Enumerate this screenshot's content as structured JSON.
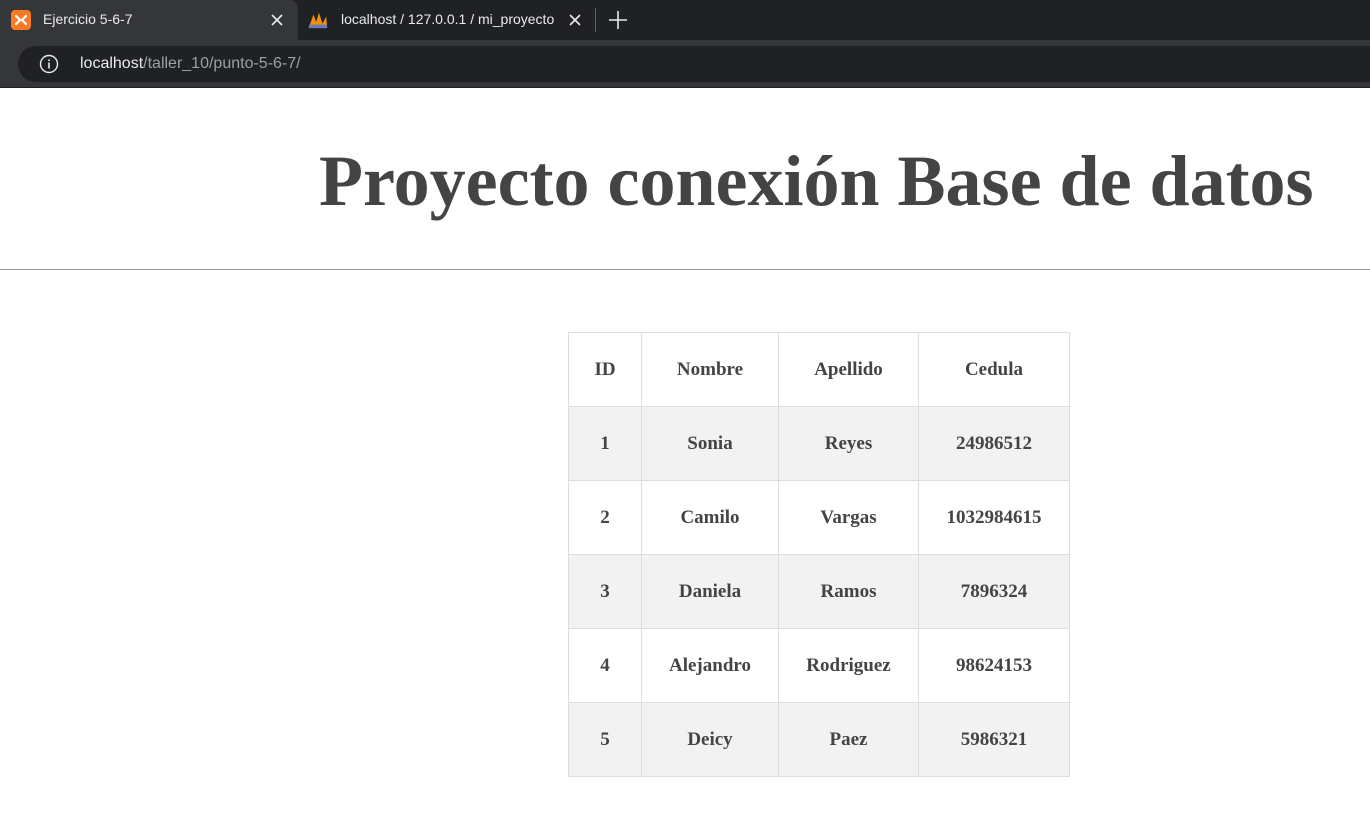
{
  "browser": {
    "tabs": [
      {
        "title": "Ejercicio 5-6-7",
        "favicon": "xampp-icon",
        "active": true
      },
      {
        "title": "localhost / 127.0.0.1 / mi_proyecto",
        "favicon": "phpmyadmin-icon",
        "active": false
      }
    ],
    "address": {
      "host": "localhost",
      "path": "/taller_10/punto-5-6-7/"
    }
  },
  "page": {
    "title": "Proyecto conexión Base de datos",
    "table": {
      "headers": [
        "ID",
        "Nombre",
        "Apellido",
        "Cedula"
      ],
      "rows": [
        [
          "1",
          "Sonia",
          "Reyes",
          "24986512"
        ],
        [
          "2",
          "Camilo",
          "Vargas",
          "1032984615"
        ],
        [
          "3",
          "Daniela",
          "Ramos",
          "7896324"
        ],
        [
          "4",
          "Alejandro",
          "Rodriguez",
          "98624153"
        ],
        [
          "5",
          "Deicy",
          "Paez",
          "5986321"
        ]
      ]
    }
  },
  "colors": {
    "text": "#444444",
    "row_shade": "#f2f2f2",
    "xampp_orange": "#fb7a24"
  }
}
